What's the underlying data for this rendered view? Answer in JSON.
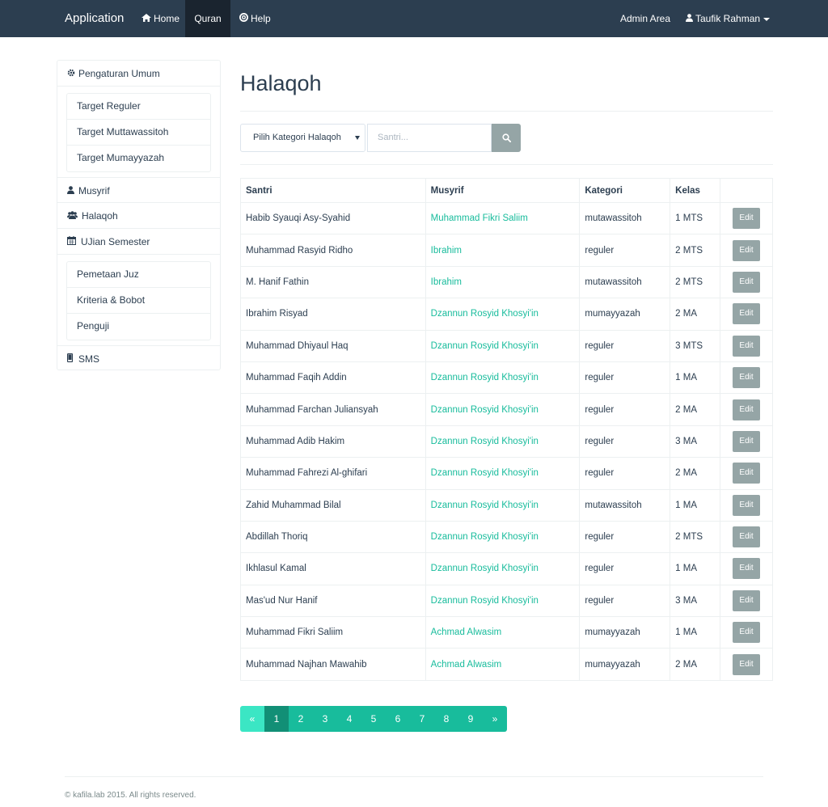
{
  "navbar": {
    "brand": "Application",
    "home": "Home",
    "quran": "Quran",
    "help": "Help",
    "admin": "Admin Area",
    "user": "Taufik Rahman"
  },
  "sidebar": {
    "pengaturan": "Pengaturan Umum",
    "pengaturan_items": [
      "Target Reguler",
      "Target Muttawassitoh",
      "Target Mumayyazah"
    ],
    "musyrif": "Musyrif",
    "halaqoh": "Halaqoh",
    "ujian": "UJian Semester",
    "ujian_items": [
      "Pemetaan Juz",
      "Kriteria & Bobot",
      "Penguji"
    ],
    "sms": "SMS"
  },
  "main": {
    "title": "Halaqoh",
    "select_label": "Pilih Kategori Halaqoh",
    "search_placeholder": "Santri..."
  },
  "table": {
    "headers": [
      "Santri",
      "Musyrif",
      "Kategori",
      "Kelas",
      ""
    ],
    "edit_label": "Edit",
    "rows": [
      [
        "Habib Syauqi Asy-Syahid",
        "Muhammad Fikri Saliim",
        "mutawassitoh",
        "1 MTS"
      ],
      [
        "Muhammad Rasyid Ridho",
        "Ibrahim",
        "reguler",
        "2 MTS"
      ],
      [
        "M. Hanif Fathin",
        "Ibrahim",
        "mutawassitoh",
        "2 MTS"
      ],
      [
        "Ibrahim Risyad",
        "Dzannun Rosyid Khosyi'in",
        "mumayyazah",
        "2 MA"
      ],
      [
        "Muhammad Dhiyaul Haq",
        "Dzannun Rosyid Khosyi'in",
        "reguler",
        "3 MTS"
      ],
      [
        "Muhammad Faqih Addin",
        "Dzannun Rosyid Khosyi'in",
        "reguler",
        "1 MA"
      ],
      [
        "Muhammad Farchan Juliansyah",
        "Dzannun Rosyid Khosyi'in",
        "reguler",
        "2 MA"
      ],
      [
        "Muhammad Adib Hakim",
        "Dzannun Rosyid Khosyi'in",
        "reguler",
        "3 MA"
      ],
      [
        "Muhammad Fahrezi Al-ghifari",
        "Dzannun Rosyid Khosyi'in",
        "reguler",
        "2 MA"
      ],
      [
        "Zahid Muhammad Bilal",
        "Dzannun Rosyid Khosyi'in",
        "mutawassitoh",
        "1 MA"
      ],
      [
        "Abdillah Thoriq",
        "Dzannun Rosyid Khosyi'in",
        "reguler",
        "2 MTS"
      ],
      [
        "Ikhlasul Kamal",
        "Dzannun Rosyid Khosyi'in",
        "reguler",
        "1 MA"
      ],
      [
        "Mas'ud Nur Hanif",
        "Dzannun Rosyid Khosyi'in",
        "reguler",
        "3 MA"
      ],
      [
        "Muhammad Fikri Saliim",
        "Achmad Alwasim",
        "mumayyazah",
        "1 MA"
      ],
      [
        "Muhammad Najhan Mawahib",
        "Achmad Alwasim",
        "mumayyazah",
        "2 MA"
      ]
    ]
  },
  "pagination": {
    "prev": "«",
    "pages": [
      "1",
      "2",
      "3",
      "4",
      "5",
      "6",
      "7",
      "8",
      "9"
    ],
    "next": "»",
    "active": "1"
  },
  "footer": {
    "text": "© kafila.lab 2015. All rights reserved."
  },
  "colors": {
    "navbar": "#2c3e50",
    "accent": "#18bc9c",
    "button": "#95a5a6"
  }
}
